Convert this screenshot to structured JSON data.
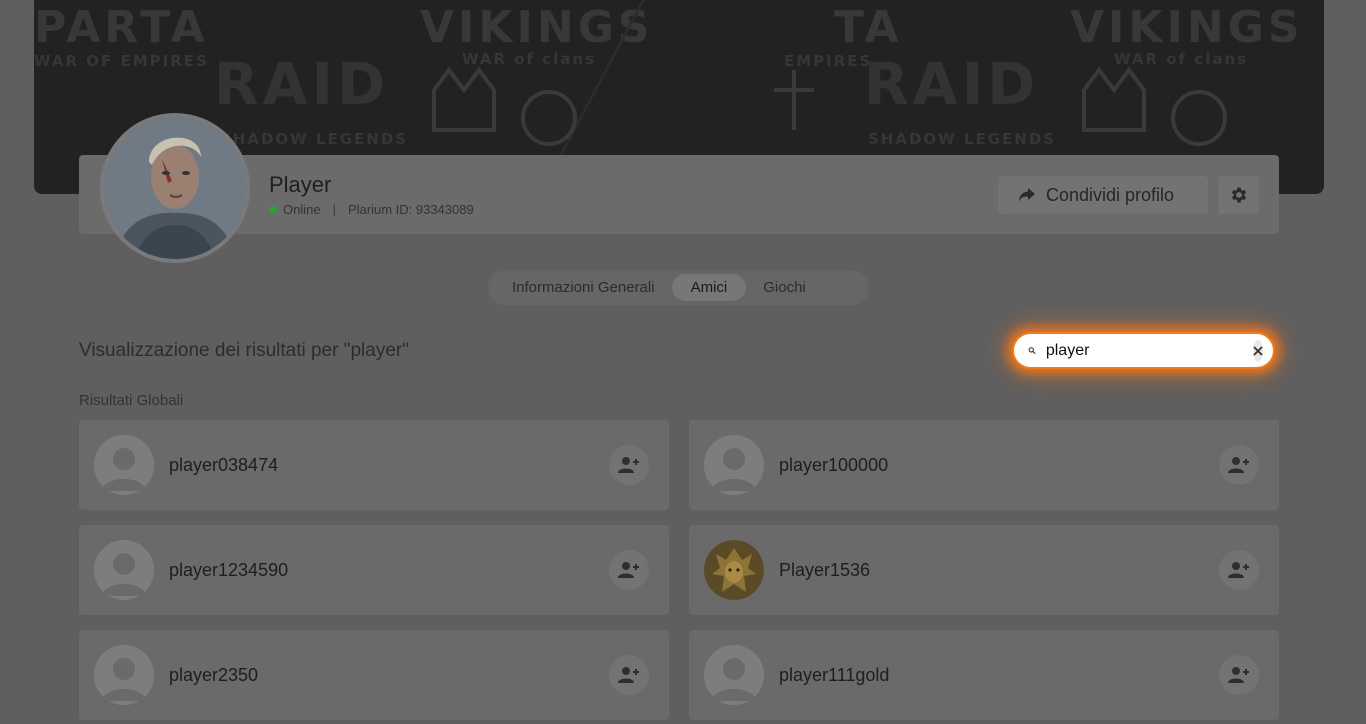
{
  "banner": {
    "words": [
      "PARTA",
      "VIKINGS",
      "RAID",
      "SHADOW LEGENDS",
      "WAR OF EMPIRES",
      "WAR of clans",
      "TA",
      "VIKINGS",
      "RAID",
      "SHADOW LEGENDS",
      "WAR of clans",
      "EMPIRES"
    ]
  },
  "profile": {
    "name": "Player",
    "status": "Online",
    "separator": "|",
    "id_label": "Plarium ID: 93343089",
    "share_label": "Condividi profilo",
    "status_color": "#2f9e3a"
  },
  "tabs": [
    {
      "label": "Informazioni Generali",
      "active": false
    },
    {
      "label": "Amici",
      "active": true
    },
    {
      "label": "Giochi",
      "active": false
    }
  ],
  "search": {
    "results_title": "Visualizzazione dei risultati per \"player\"",
    "value": "player",
    "highlight_color": "#f07a1c"
  },
  "section_label": "Risultati Globali",
  "users": [
    {
      "name": "player038474",
      "custom_avatar": false
    },
    {
      "name": "player100000",
      "custom_avatar": false
    },
    {
      "name": "player1234590",
      "custom_avatar": false
    },
    {
      "name": "Player1536",
      "custom_avatar": true
    },
    {
      "name": "player2350",
      "custom_avatar": false
    },
    {
      "name": "player111gold",
      "custom_avatar": false
    }
  ]
}
